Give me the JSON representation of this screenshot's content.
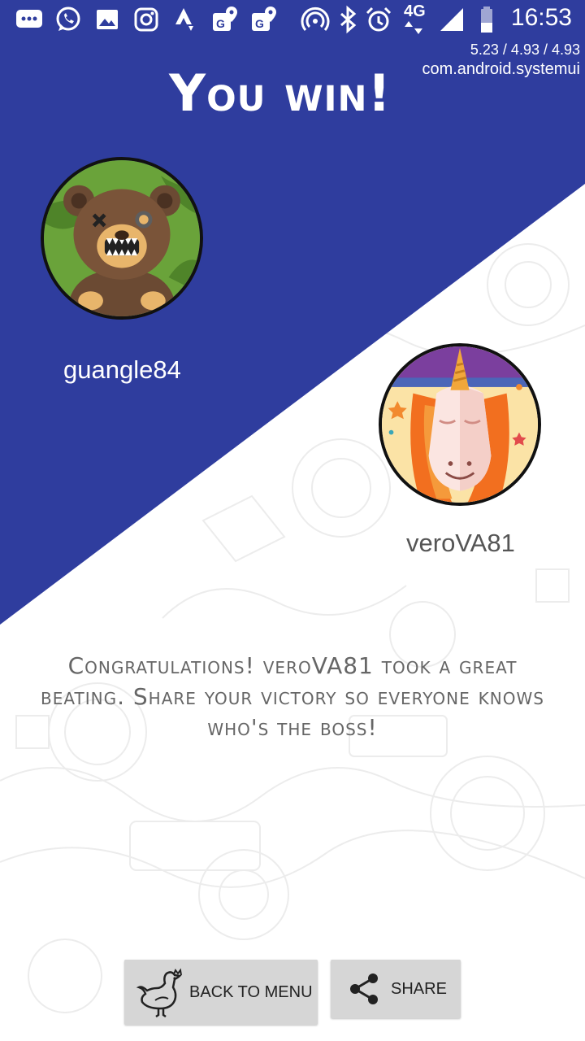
{
  "status_bar": {
    "time": "16:53",
    "network": "4G",
    "icons": [
      "messages-icon",
      "whatsapp-icon",
      "gallery-icon",
      "instagram-icon",
      "strava-icon",
      "maps-icon",
      "maps-icon",
      "hotspot-icon",
      "bluetooth-icon",
      "alarm-icon",
      "signal-icon",
      "battery-icon"
    ]
  },
  "debug_overlay": {
    "load": "5.23 / 4.93 / 4.93",
    "process": "com.android.systemui"
  },
  "title": "You win!",
  "winner": {
    "name": "guangle84",
    "avatar": "bear-avatar"
  },
  "loser": {
    "name": "veroVA81",
    "avatar": "unicorn-avatar"
  },
  "message": "Congratulations! veroVA81 took a great beating. Share your victory so everyone knows who's the boss!",
  "buttons": {
    "back_label": "BACK TO MENU",
    "share_label": "SHARE"
  },
  "colors": {
    "accent_blue": "#2f3d9e",
    "button_bg": "#d6d6d6"
  }
}
